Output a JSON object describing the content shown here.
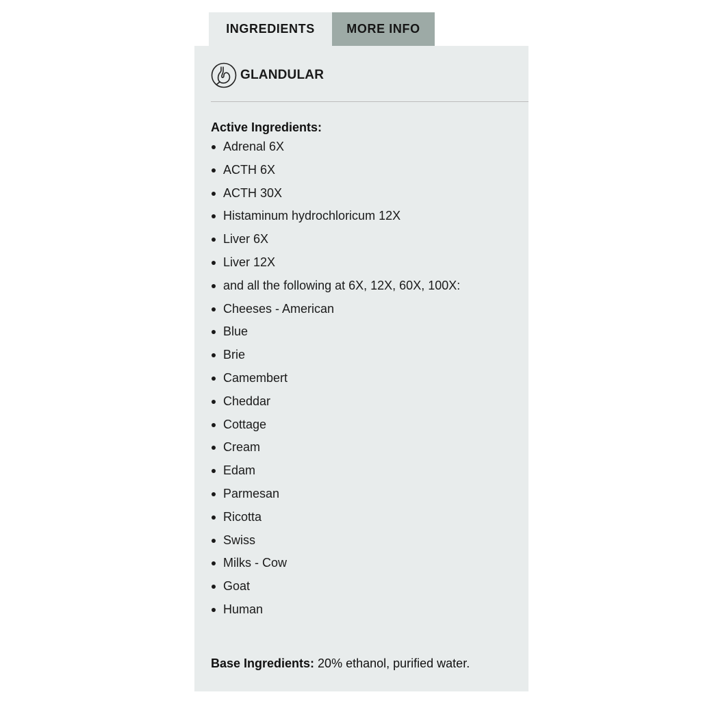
{
  "tabs": [
    {
      "label": "INGREDIENTS",
      "active": true
    },
    {
      "label": "MORE INFO",
      "active": false
    }
  ],
  "colors": {
    "panel_bg": "#e8ecec",
    "inactive_tab_bg": "#9daaa6",
    "text": "#111111"
  },
  "category": {
    "icon": "stomach-icon",
    "label": "GLANDULAR"
  },
  "active_ingredients": {
    "heading": "Active Ingredients:",
    "items": [
      "Adrenal 6X",
      "ACTH 6X",
      "ACTH 30X",
      "Histaminum hydrochloricum 12X",
      "Liver 6X",
      "Liver 12X",
      "and all the following at 6X, 12X, 60X, 100X:",
      "Cheeses - American",
      "Blue",
      "Brie",
      "Camembert",
      "Cheddar",
      "Cottage",
      "Cream",
      "Edam",
      "Parmesan",
      "Ricotta",
      "Swiss",
      "Milks - Cow",
      "Goat",
      "Human"
    ]
  },
  "base_ingredients": {
    "label": "Base Ingredients:",
    "value": " 20% ethanol, purified water."
  }
}
